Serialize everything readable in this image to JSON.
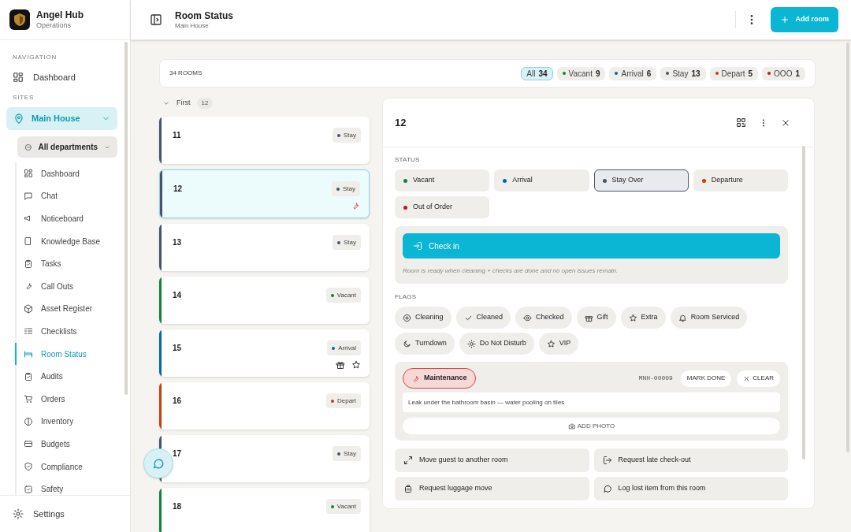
{
  "app": {
    "name": "Angel Hub",
    "subtitle": "Operations"
  },
  "sidebar": {
    "navigation_label": "NAVIGATION",
    "navigation": [
      {
        "label": "Dashboard"
      }
    ],
    "sites_label": "SITES",
    "site": {
      "label": "Main House",
      "expanded": true
    },
    "department": {
      "label": "All departments"
    },
    "items": [
      {
        "label": "Dashboard",
        "selected": false
      },
      {
        "label": "Chat",
        "selected": false
      },
      {
        "label": "Noticeboard",
        "selected": false
      },
      {
        "label": "Knowledge Base",
        "selected": false
      },
      {
        "label": "Tasks",
        "selected": false
      },
      {
        "label": "Call Outs",
        "selected": false
      },
      {
        "label": "Asset Register",
        "selected": false
      },
      {
        "label": "Checklists",
        "selected": false
      },
      {
        "label": "Room Status",
        "selected": true
      },
      {
        "label": "Audits",
        "selected": false
      },
      {
        "label": "Orders",
        "selected": false
      },
      {
        "label": "Inventory",
        "selected": false
      },
      {
        "label": "Budgets",
        "selected": false
      },
      {
        "label": "Compliance",
        "selected": false
      },
      {
        "label": "Safety",
        "selected": false
      }
    ],
    "settings": "Settings"
  },
  "header": {
    "title": "Room Status",
    "subtitle": "Main House",
    "add_button": "Add room"
  },
  "summary": {
    "total": "34 ROOMS",
    "filters": [
      {
        "label": "All",
        "count": "34",
        "selected": true
      },
      {
        "label": "Vacant",
        "count": "9",
        "color": "#15803d",
        "selected": false
      },
      {
        "label": "Arrival",
        "count": "6",
        "color": "#0369a1",
        "selected": false
      },
      {
        "label": "Stay",
        "count": "13",
        "color": "#475569",
        "selected": false
      },
      {
        "label": "Depart",
        "count": "5",
        "color": "#c2410c",
        "selected": false
      },
      {
        "label": "OOO",
        "count": "1",
        "color": "#b91c1c",
        "selected": false
      }
    ]
  },
  "floor": {
    "label": "First",
    "count": "12",
    "expanded": true
  },
  "rooms": [
    {
      "number": "11",
      "status": "Stay",
      "color": "#475569",
      "selected": false
    },
    {
      "number": "12",
      "status": "Stay",
      "color": "#475569",
      "selected": true,
      "maintenance": true
    },
    {
      "number": "13",
      "status": "Stay",
      "color": "#475569",
      "selected": false
    },
    {
      "number": "14",
      "status": "Vacant",
      "color": "#15803d",
      "selected": false
    },
    {
      "number": "15",
      "status": "Arrival",
      "color": "#0369a1",
      "selected": false,
      "gift": true,
      "extra": true
    },
    {
      "number": "16",
      "status": "Depart",
      "color": "#c2410c",
      "selected": false
    },
    {
      "number": "17",
      "status": "Stay",
      "color": "#475569",
      "selected": false
    },
    {
      "number": "18",
      "status": "Vacant",
      "color": "#15803d",
      "selected": false
    }
  ],
  "detail": {
    "title": "12",
    "status_label": "STATUS",
    "statuses": [
      {
        "label": "Vacant",
        "color": "#15803d",
        "selected": false
      },
      {
        "label": "Arrival",
        "color": "#0369a1",
        "selected": false
      },
      {
        "label": "Stay Over",
        "color": "#475569",
        "selected": true
      },
      {
        "label": "Departure",
        "color": "#c2410c",
        "selected": false
      },
      {
        "label": "Out of Order",
        "color": "#b91c1c",
        "selected": false
      }
    ],
    "check_in": "Check in",
    "hint": "Room is ready when cleaning + checks are done and no open issues remain.",
    "flags_label": "FLAGS",
    "flags": [
      {
        "label": "Cleaning"
      },
      {
        "label": "Cleaned"
      },
      {
        "label": "Checked"
      },
      {
        "label": "Gift"
      },
      {
        "label": "Extra"
      },
      {
        "label": "Room Serviced"
      },
      {
        "label": "Turndown"
      },
      {
        "label": "Do Not Disturb"
      },
      {
        "label": "VIP"
      }
    ],
    "maintenance": {
      "tag": "Maintenance",
      "code": "MNH-00009",
      "mark_done": "MARK DONE",
      "clear": "CLEAR",
      "description": "Leak under the bathroom basin — water pooling on tiles",
      "add_photo": "ADD PHOTO"
    },
    "actions": [
      {
        "label": "Move guest to another room"
      },
      {
        "label": "Request late check-out"
      },
      {
        "label": "Request luggage move"
      },
      {
        "label": "Log lost item from this room"
      }
    ]
  }
}
